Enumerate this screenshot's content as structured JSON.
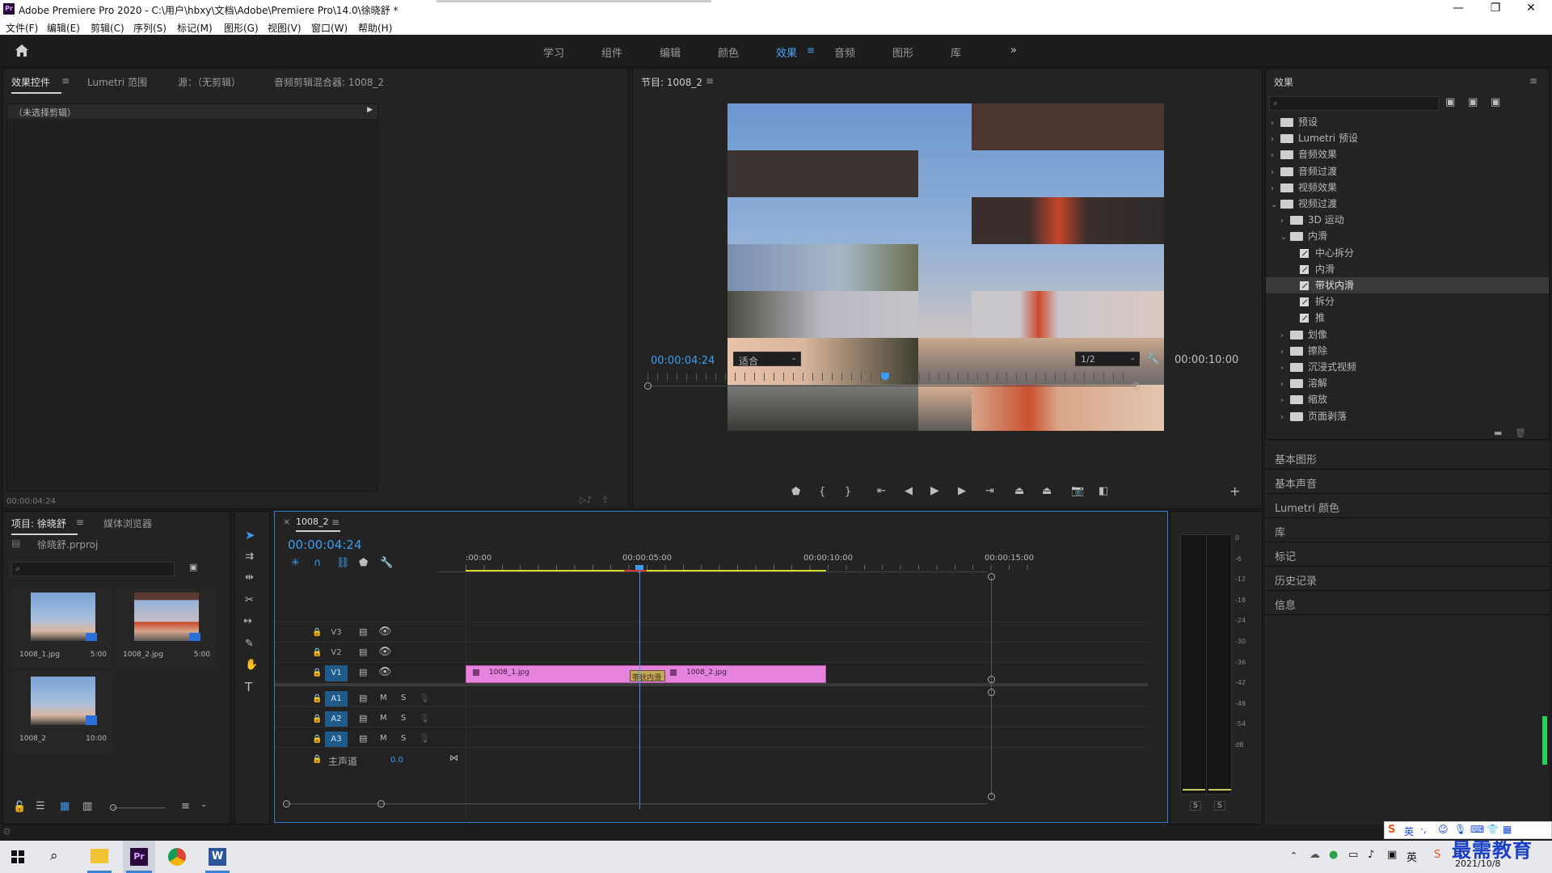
{
  "window": {
    "title": "Adobe Premiere Pro 2020 - C:\\用户\\hbxy\\文档\\Adobe\\Premiere Pro\\14.0\\徐晓舒 *",
    "minimize": "—",
    "maximize": "❐",
    "close": "✕",
    "app_icon": "Pr"
  },
  "menu": [
    "文件(F)",
    "编辑(E)",
    "剪辑(C)",
    "序列(S)",
    "标记(M)",
    "图形(G)",
    "视图(V)",
    "窗口(W)",
    "帮助(H)"
  ],
  "workspaces": [
    "学习",
    "组件",
    "编辑",
    "颜色",
    "效果",
    "音频",
    "图形",
    "库"
  ],
  "workspace_active": "效果",
  "workspace_more": "»",
  "source_panel": {
    "tabs": [
      "效果控件",
      "Lumetri 范围",
      "源：（无剪辑）",
      "音频剪辑混合器: 1008_2"
    ],
    "no_clip": "（未选择剪辑）",
    "timecode": "00:00:04:24"
  },
  "program": {
    "title": "节目: 1008_2",
    "timecode": "00:00:04:24",
    "fit": "适合",
    "resolution": "1/2",
    "duration": "00:00:10:00",
    "playhead_fraction": 0.49
  },
  "effects": {
    "title": "效果",
    "search_placeholder": "",
    "tree": [
      {
        "label": "预设",
        "type": "preset",
        "level": 0,
        "open": false
      },
      {
        "label": "Lumetri 预设",
        "type": "preset",
        "level": 0,
        "open": false
      },
      {
        "label": "音频效果",
        "type": "folder",
        "level": 0,
        "open": false
      },
      {
        "label": "音频过渡",
        "type": "folder",
        "level": 0,
        "open": false
      },
      {
        "label": "视频效果",
        "type": "folder",
        "level": 0,
        "open": false
      },
      {
        "label": "视频过渡",
        "type": "folder",
        "level": 0,
        "open": true
      },
      {
        "label": "3D 运动",
        "type": "folder",
        "level": 1,
        "open": false
      },
      {
        "label": "内滑",
        "type": "folder",
        "level": 1,
        "open": true
      },
      {
        "label": "中心拆分",
        "type": "fx",
        "level": 2
      },
      {
        "label": "内滑",
        "type": "fx",
        "level": 2
      },
      {
        "label": "带状内滑",
        "type": "fx",
        "level": 2,
        "selected": true
      },
      {
        "label": "拆分",
        "type": "fx",
        "level": 2
      },
      {
        "label": "推",
        "type": "fx",
        "level": 2
      },
      {
        "label": "划像",
        "type": "folder",
        "level": 1,
        "open": false
      },
      {
        "label": "擦除",
        "type": "folder",
        "level": 1,
        "open": false
      },
      {
        "label": "沉浸式视频",
        "type": "folder",
        "level": 1,
        "open": false
      },
      {
        "label": "溶解",
        "type": "folder",
        "level": 1,
        "open": false
      },
      {
        "label": "缩放",
        "type": "folder",
        "level": 1,
        "open": false
      },
      {
        "label": "页面剥落",
        "type": "folder",
        "level": 1,
        "open": false
      }
    ]
  },
  "side_panels": [
    "基本图形",
    "基本声音",
    "Lumetri 颜色",
    "库",
    "标记",
    "历史记录",
    "信息"
  ],
  "project": {
    "tabs": [
      "项目: 徐晓舒",
      "媒体浏览器"
    ],
    "file": "徐晓舒.prproj",
    "items": [
      {
        "name": "1008_1.jpg",
        "dur": "5:00"
      },
      {
        "name": "1008_2.jpg",
        "dur": "5:00"
      },
      {
        "name": "1008_2",
        "dur": "10:00"
      }
    ]
  },
  "timeline": {
    "tab": "1008_2",
    "timecode": "00:00:04:24",
    "ruler": [
      ":00:00",
      "00:00:05:00",
      "00:00:10:00",
      "00:00:15:00"
    ],
    "video_tracks": [
      "V3",
      "V2",
      "V1"
    ],
    "audio_tracks": [
      "A1",
      "A2",
      "A3"
    ],
    "master": "主声道",
    "master_val": "0.0",
    "clips": [
      {
        "name": "1008_1.jpg"
      },
      {
        "name": "1008_2.jpg"
      }
    ],
    "transition": "带状内滑",
    "mute": "M",
    "solo": "S"
  },
  "meter": {
    "scale": [
      "0",
      "-6",
      "-12",
      "-18",
      "-24",
      "-30",
      "-36",
      "-42",
      "-48",
      "-54",
      "dB"
    ],
    "solo": [
      "S",
      "S"
    ]
  },
  "tray": {
    "ime": "英",
    "date": "2021/10/8",
    "watermark": "最需教育"
  },
  "colors": {
    "accent": "#3d9cf0",
    "clip": "#e683dc",
    "panel": "#232323",
    "workarea": "#d9d72b"
  }
}
